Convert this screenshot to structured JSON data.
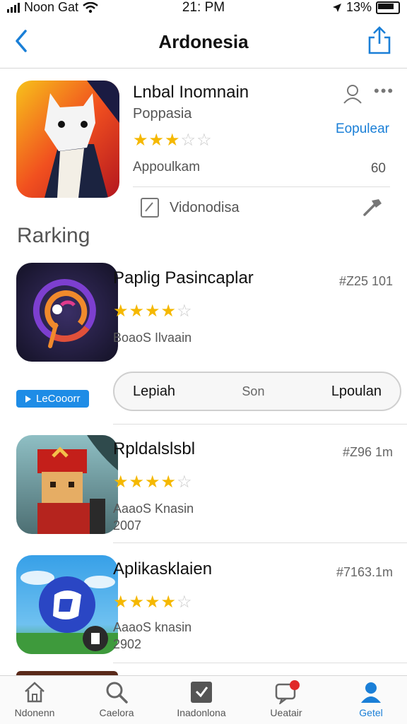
{
  "status_bar": {
    "carrier": "Noon Gat",
    "time": "21: PM",
    "battery": "13%"
  },
  "nav": {
    "title": "Ardonesia",
    "icons": [
      "back-chevron-icon",
      "share-icon"
    ]
  },
  "featured": {
    "title": "Lnbal Inomnain",
    "subtitle": "Poppasia",
    "rating": 3,
    "category": "Eopulear",
    "meta": "Appoulkam",
    "meta_value": "60",
    "link_text": "Vidonodisa"
  },
  "section_title": "Rarking",
  "ranking": [
    {
      "name": "Paplig Pasincaplar",
      "rank": "#Z25 101",
      "rating": 4.5,
      "meta": "BoaoS Ilvaain",
      "meta2": ""
    },
    {
      "name": "Rpldalslsbl",
      "rank": "#Z96 1m",
      "rating": 4.5,
      "meta": "AaaoS Knasin",
      "meta2": "2007"
    },
    {
      "name": "Aplikasklaien",
      "rank": "#7163.1m",
      "rating": 4.5,
      "meta": "AaaoS knasin",
      "meta2": "2902"
    }
  ],
  "badge": "LeCooorr",
  "segments": [
    "Lepiah",
    "Son",
    "Lpoulan"
  ],
  "tabs": [
    "Ndonenn",
    "Caelora",
    "Inadonlona",
    "Ueatair",
    "Getel"
  ],
  "colors": {
    "accent": "#1a7fd7",
    "star": "#f5b800"
  }
}
